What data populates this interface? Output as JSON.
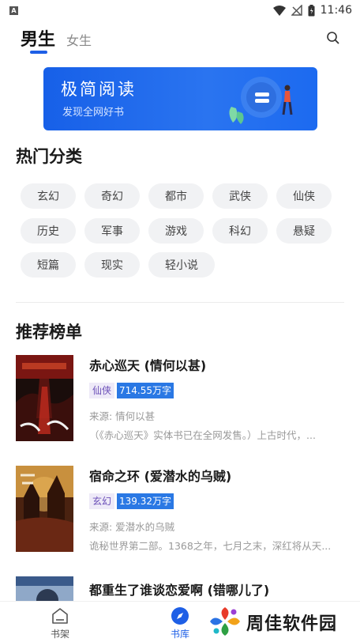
{
  "status_bar": {
    "time": "11:46",
    "notification_icon": "A"
  },
  "tabs": {
    "male": "男生",
    "female": "女生"
  },
  "banner": {
    "title": "极简阅读",
    "subtitle": "发现全网好书"
  },
  "categories": {
    "title": "热门分类",
    "items": [
      "玄幻",
      "奇幻",
      "都市",
      "武侠",
      "仙侠",
      "历史",
      "军事",
      "游戏",
      "科幻",
      "悬疑",
      "短篇",
      "现实",
      "轻小说"
    ]
  },
  "ranking": {
    "title": "推荐榜单",
    "books": [
      {
        "title": "赤心巡天 (情何以甚)",
        "category": "仙侠",
        "words": "714.55万字",
        "author": "来源: 情何以甚",
        "desc": "（《赤心巡天》实体书已在全网发售。）上古时代，..."
      },
      {
        "title": "宿命之环 (爱潜水的乌贼)",
        "category": "玄幻",
        "words": "139.32万字",
        "author": "来源: 爱潜水的乌贼",
        "desc": "诡秘世界第二部。1368之年，七月之末，深红将从天..."
      },
      {
        "title": "都重生了谁谈恋爱啊 (错哪儿了)"
      }
    ]
  },
  "bottom_nav": {
    "bookshelf": "书架",
    "library": "书库"
  },
  "watermark": {
    "text": "周佳软件园"
  },
  "colors": {
    "accent": "#1e5fe6",
    "tag_words": "#2a78e4",
    "tag_category": "#6b4fb8"
  }
}
